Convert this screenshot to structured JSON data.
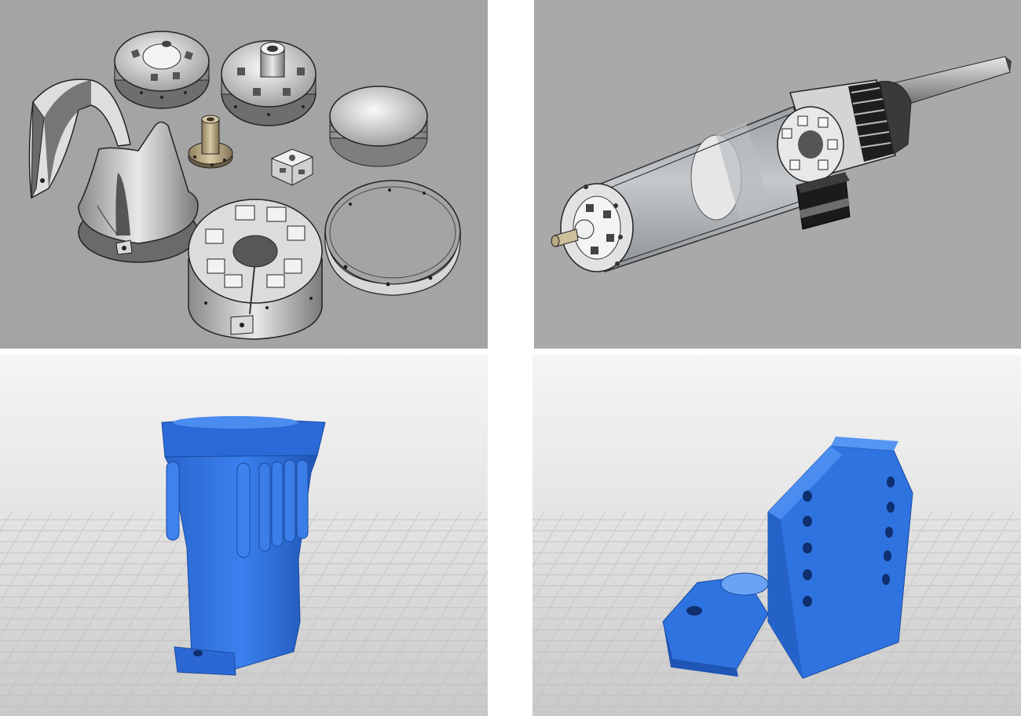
{
  "panels": [
    {
      "id": "exploded-parts-render",
      "background": "#a4a4a4"
    },
    {
      "id": "assembled-actuator-render",
      "background": "#a9a9a9"
    },
    {
      "id": "blue-print-funnel-part",
      "color": "#2f73e0"
    },
    {
      "id": "blue-print-bracket-part",
      "color": "#2f73e0"
    }
  ],
  "colors": {
    "render_gray": "#a6a6a6",
    "part_light": "#e6e6e6",
    "print_blue": "#2f73e0",
    "print_blue_dark": "#1f55b4",
    "floor": "#e3e3e3"
  }
}
